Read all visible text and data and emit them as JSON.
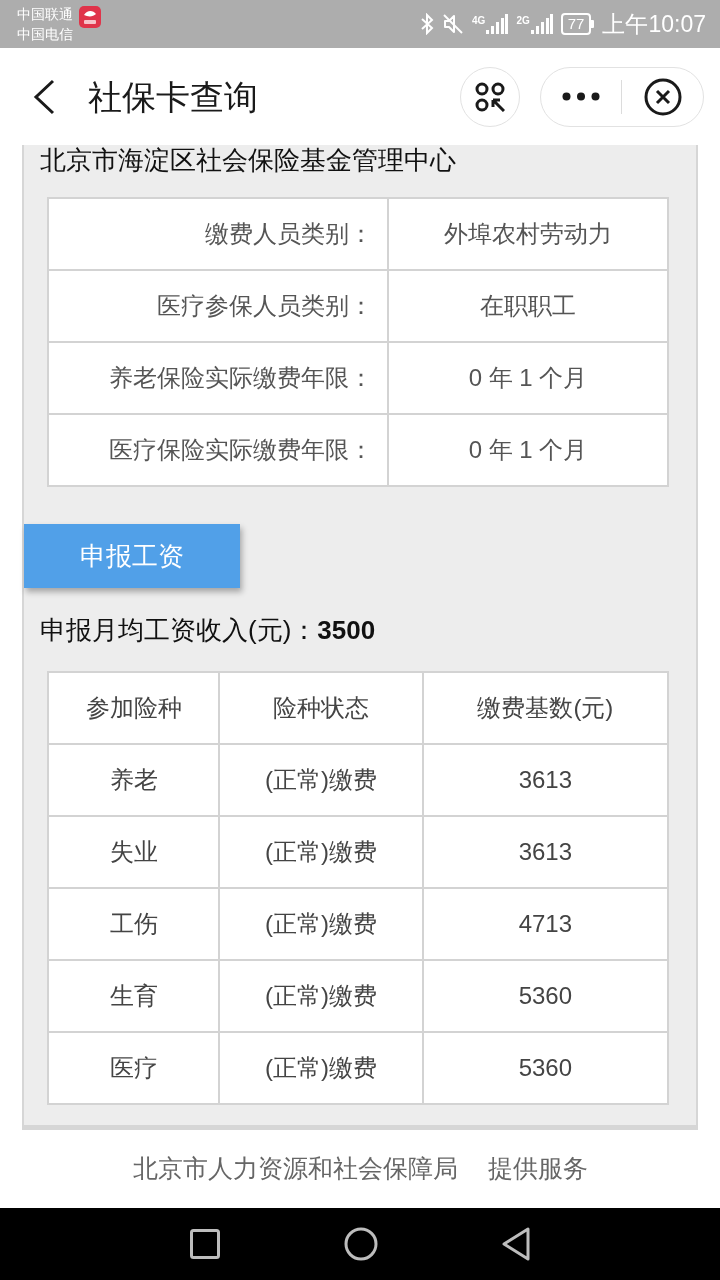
{
  "status_bar": {
    "carriers": [
      "中国联通",
      "中国电信"
    ],
    "networks": [
      "4G",
      "2G"
    ],
    "battery": "77",
    "time": "上午10:07"
  },
  "nav_bar": {
    "title": "社保卡查询"
  },
  "section_title": "北京市海淀区社会保险基金管理中心",
  "info_table": {
    "rows": [
      {
        "label": "缴费人员类别：",
        "value": "外埠农村劳动力"
      },
      {
        "label": "医疗参保人员类别：",
        "value": "在职职工"
      },
      {
        "label": "养老保险实际缴费年限：",
        "value": "0 年 1 个月"
      },
      {
        "label": "医疗保险实际缴费年限：",
        "value": "0 年 1 个月"
      }
    ]
  },
  "declare_button": "申报工资",
  "declared_wage": "申报月均工资收入(元)：**3500**",
  "insurance_table": {
    "columns": [
      "参加险种",
      "险种状态",
      "缴费基数(元)"
    ],
    "rows": [
      [
        "养老",
        "(正常)缴费",
        "3613"
      ],
      [
        "失业",
        "(正常)缴费",
        "3613"
      ],
      [
        "工伤",
        "(正常)缴费",
        "4713"
      ],
      [
        "生育",
        "(正常)缴费",
        "5360"
      ],
      [
        "医疗",
        "(正常)缴费",
        "5360"
      ]
    ]
  },
  "footer": {
    "provider": "北京市人力资源和社会保障局",
    "note": "提供服务"
  }
}
